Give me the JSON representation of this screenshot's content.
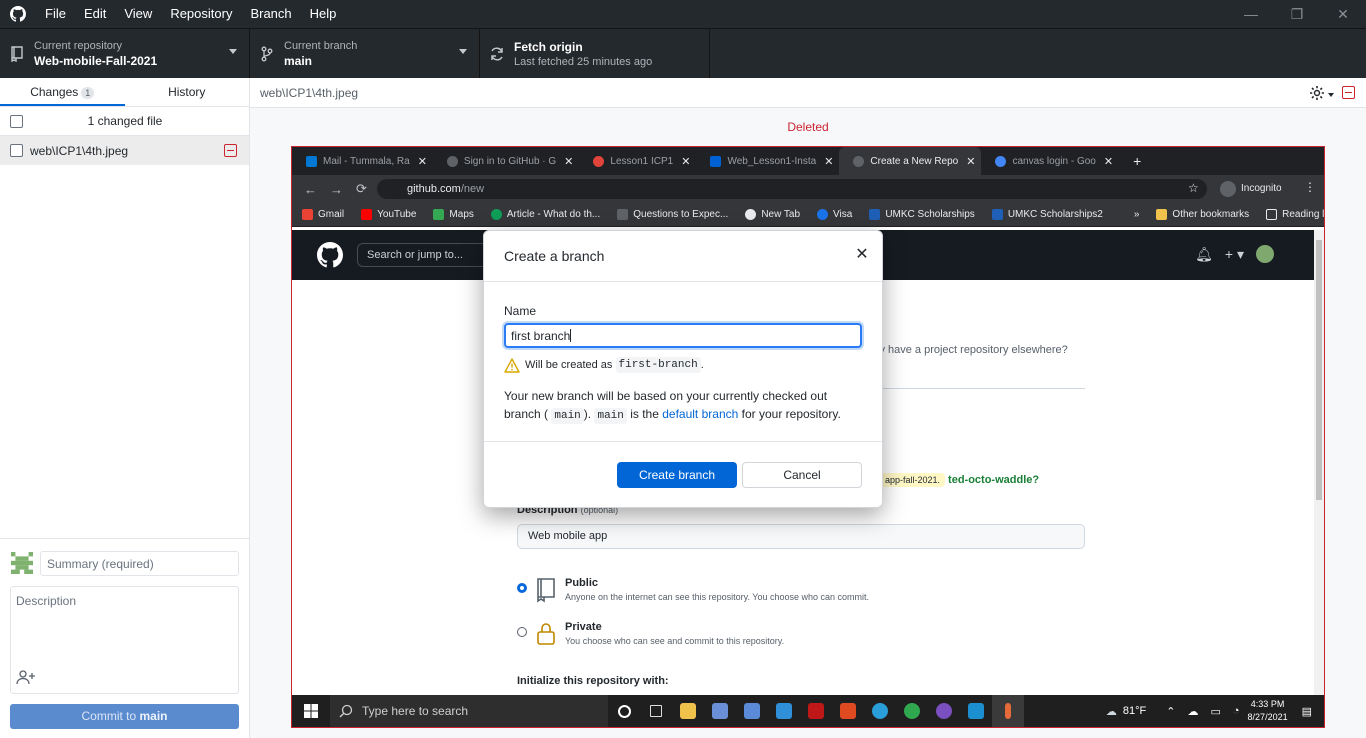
{
  "menu": [
    "File",
    "Edit",
    "View",
    "Repository",
    "Branch",
    "Help"
  ],
  "toolbar": {
    "repo_label": "Current repository",
    "repo_value": "Web-mobile-Fall-2021",
    "branch_label": "Current branch",
    "branch_value": "main",
    "fetch_label": "Fetch origin",
    "fetch_sub": "Last fetched 25 minutes ago"
  },
  "sidebar": {
    "tab_changes": "Changes",
    "changes_count": "1",
    "tab_history": "History",
    "changed_files_label": "1 changed file",
    "file_name": "web\\ICP1\\4th.jpeg"
  },
  "commit": {
    "summary_placeholder": "Summary (required)",
    "description_placeholder": "Description",
    "button_prefix": "Commit to ",
    "button_branch": "main"
  },
  "main": {
    "path": "web\\ICP1\\4th.jpeg",
    "status": "Deleted"
  },
  "screenshot": {
    "tabs": [
      {
        "label": "Mail - Tummala, Ra",
        "color": "#0078d4"
      },
      {
        "label": "Sign in to GitHub · G",
        "color": "#5f6368"
      },
      {
        "label": "Lesson1 ICP1",
        "color": "#e0443a"
      },
      {
        "label": "Web_Lesson1-Insta",
        "color": "#0061d5"
      },
      {
        "label": "Create a New Repo",
        "color": "#5f6368"
      },
      {
        "label": "canvas login - Goo",
        "color": "#4285f4"
      }
    ],
    "url_host": "github.com",
    "url_path": "/new",
    "incognito": "Incognito",
    "bookmarks": [
      {
        "label": "Gmail",
        "color": "#ea4335"
      },
      {
        "label": "YouTube",
        "color": "#ff0000"
      },
      {
        "label": "Maps",
        "color": "#34a853"
      },
      {
        "label": "Article - What do th...",
        "color": "#0f9d58"
      },
      {
        "label": "Questions to Expec...",
        "color": "#9aa0a6"
      },
      {
        "label": "New Tab",
        "color": "#e8eaed"
      },
      {
        "label": "Visa",
        "color": "#1a73e8"
      },
      {
        "label": "UMKC Scholarships",
        "color": "#1f5fb5"
      },
      {
        "label": "UMKC Scholarships2",
        "color": "#1f5fb5"
      }
    ],
    "bookmarks_overflow": "»",
    "other_bookmarks": "Other bookmarks",
    "reading_list": "Reading list",
    "gh_search": "Search or jump to...",
    "elsewhere_text": "ly have a project repository elsewhere?",
    "suggest_chip": "app-fall-2021.",
    "suggest_name": "ted-octo-waddle?",
    "description_label": "Description",
    "description_optional": "(optional)",
    "description_value": "Web mobile app",
    "public_title": "Public",
    "public_desc": "Anyone on the internet can see this repository. You choose who can commit.",
    "private_title": "Private",
    "private_desc": "You choose who can see and commit to this repository.",
    "init_label": "Initialize this repository with:",
    "taskbar_search": "Type here to search",
    "weather": "81°F",
    "time": "4:33 PM",
    "date": "8/27/2021"
  },
  "dialog": {
    "title": "Create a branch",
    "name_label": "Name",
    "name_value": "first branch",
    "warn_prefix": "Will be created as",
    "warn_code": "first-branch",
    "warn_suffix": ".",
    "explain_1": "Your new branch will be based on your currently checked out",
    "explain_2a": "branch (",
    "explain_code1": "main",
    "explain_2b": ").",
    "explain_code2": "main",
    "explain_2c": " is the ",
    "explain_link": "default branch",
    "explain_2d": " for your repository.",
    "create_label": "Create branch",
    "cancel_label": "Cancel"
  },
  "colors": {
    "accent": "#0366d6",
    "danger": "#cb2431",
    "toolbar_bg": "#24292e"
  }
}
